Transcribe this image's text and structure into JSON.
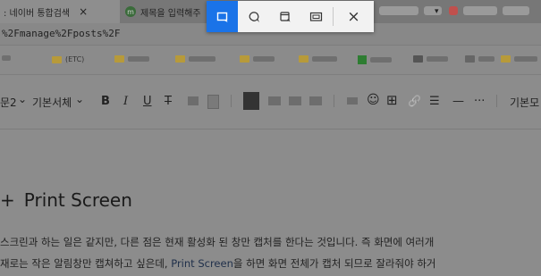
{
  "browser": {
    "tabs": [
      {
        "label": ": 네이버 통합검색",
        "close": "×"
      },
      {
        "label": "제목을 입력해주",
        "favicon": "m"
      }
    ],
    "tab_menu": "▾",
    "url": "%2Fmanage%2Fposts%2F"
  },
  "bookmarks": {
    "items": [
      {
        "label": "(ETC)"
      }
    ]
  },
  "editor_toolbar": {
    "paragraph_style": "문2",
    "paragraph_chevron": "⌄",
    "font": "기본서체",
    "font_chevron": "⌄",
    "bold": "B",
    "italic": "I",
    "underline": "U",
    "strike": "T",
    "emoji": "☺",
    "table": "⊞",
    "link": "🔗",
    "list": "☰",
    "hr": "—",
    "more": "···",
    "right_label": "기본모"
  },
  "document": {
    "heading_bullet": "+",
    "heading": "Print Screen",
    "para1": "스크린과 하는 일은 같지만, 다른 점은 현재 활성화 된 창만 캡처를 한다는 것입니다. 즉 화면에 여러개",
    "para2_part1": "재로는 작은 알림창만 캡쳐하고 싶은데,  ",
    "para2_strong": "Print Screen",
    "para2_part2": "을 하면 화면 전체가 캡처 되므로 잘라줘야 하거"
  },
  "snip_toolbar": {
    "modes": [
      "rectangle-snip",
      "freeform-snip",
      "window-snip",
      "fullscreen-snip"
    ],
    "close": "×",
    "active_color": "#1a73e8"
  }
}
